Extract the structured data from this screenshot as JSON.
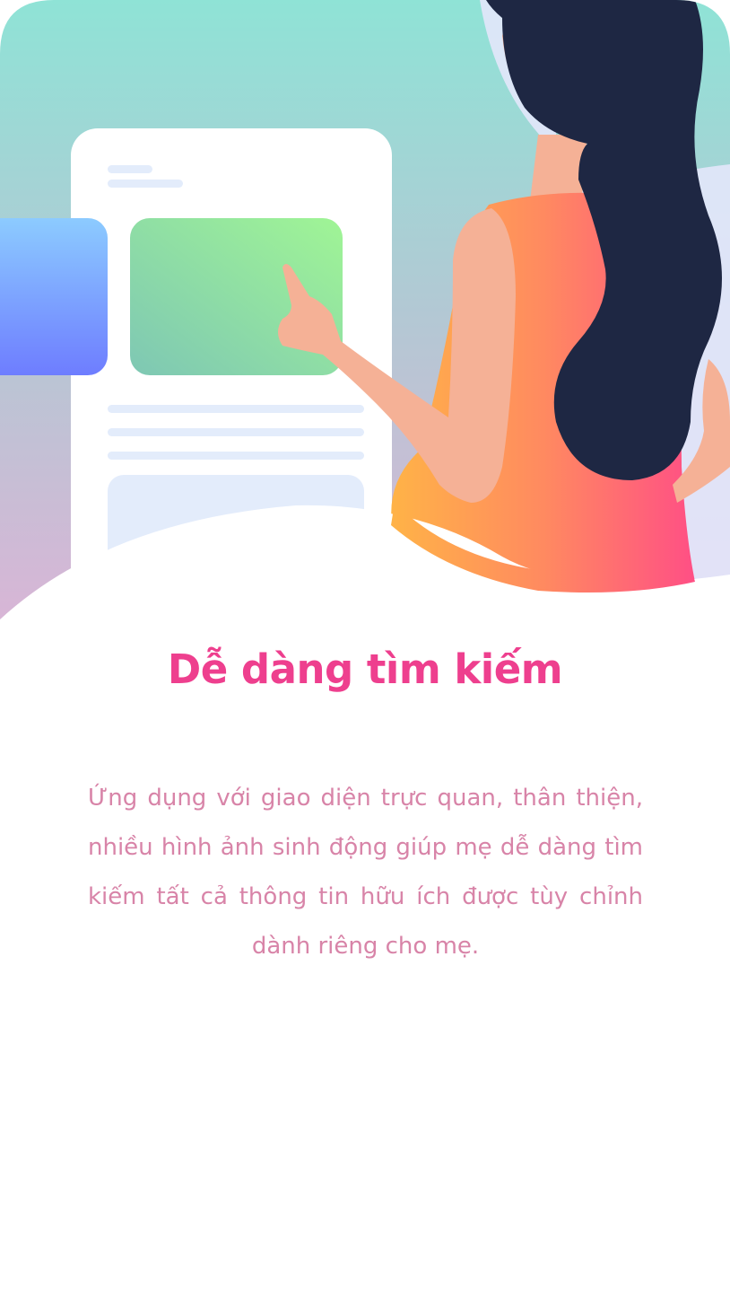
{
  "onboarding": {
    "title": "Dễ dàng tìm kiếm",
    "description": "Ứng dụng với giao diện trực quan, thân thiện, nhiều hình ảnh sinh động giúp mẹ dễ dàng tìm kiếm tất cả thông tin hữu ích được tùy chỉnh dành riêng cho mẹ.",
    "illustration_icon": "woman-touching-app-screen-illustration"
  },
  "colors": {
    "title": "#ee3f8e",
    "description": "#d884a8",
    "background_top": "#8fe3d6",
    "background_bottom": "#d9b5d6",
    "hair": "#1e2743",
    "skin": "#f5b196",
    "dress_start": "#ffb347",
    "dress_end": "#ff4f85",
    "green_card": "#9ef596",
    "blue_card": "#6e86ff"
  }
}
